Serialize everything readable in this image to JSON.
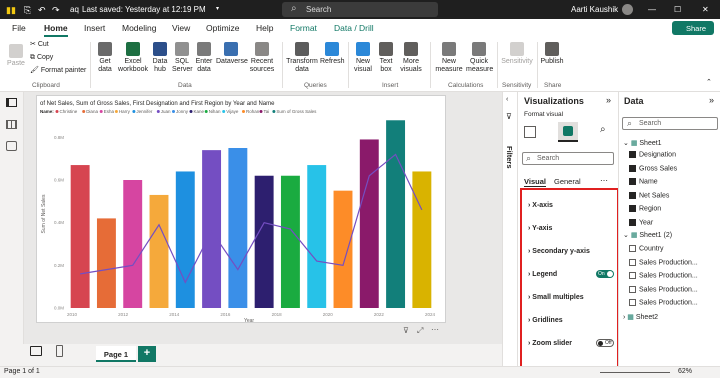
{
  "titlebar": {
    "app_name": "aq",
    "saved_status": "Last saved: Yesterday at 12:19 PM",
    "search_placeholder": "Search",
    "user_name": "Aarti Kaushik"
  },
  "menu": {
    "tabs": [
      "File",
      "Home",
      "Insert",
      "Modeling",
      "View",
      "Optimize",
      "Help",
      "Format",
      "Data / Drill"
    ],
    "active": "Home",
    "share_label": "Share"
  },
  "ribbon": {
    "paste": "Paste",
    "cut": "Cut",
    "copy": "Copy",
    "format_painter": "Format painter",
    "clipboard_group": "Clipboard",
    "get_data": "Get data",
    "excel": "Excel workbook",
    "data_hub": "Data hub",
    "sql": "SQL Server",
    "enter_data": "Enter data",
    "dataverse": "Dataverse",
    "recent": "Recent sources",
    "data_group": "Data",
    "transform": "Transform data",
    "refresh": "Refresh",
    "queries_group": "Queries",
    "new_visual": "New visual",
    "text_box": "Text box",
    "more_visuals": "More visuals",
    "insert_group": "Insert",
    "new_measure": "New measure",
    "quick_measure": "Quick measure",
    "calc_group": "Calculations",
    "sensitivity": "Sensitivity",
    "sensitivity_group": "Sensitivity",
    "publish": "Publish",
    "share_group": "Share"
  },
  "chart_data": {
    "type": "bar",
    "title": "of Net Sales, Sum of Gross Sales, First Designation and First Region by Year and Name",
    "legend_title": "Name",
    "legend": [
      "Christine",
      "Diana",
      "Esha",
      "Harry",
      "Jennifer",
      "Juan",
      "Jonny",
      "Kane",
      "Nihan",
      "Vijaye",
      "Rohan",
      "Tai",
      "Sum of Gross Sales"
    ],
    "x_ticks": [
      "2010",
      "2012",
      "2014",
      "2016",
      "2018",
      "2020",
      "2022",
      "2024"
    ],
    "y_ticks": [
      "0.0M",
      "0.2M",
      "0.4M",
      "0.6M",
      "0.8M"
    ],
    "xlabel": "Year",
    "ylabel": "Sum of Net Sales",
    "ylim": [
      0,
      0.9
    ],
    "bar_values": [
      0.67,
      0.42,
      0.6,
      0.53,
      0.64,
      0.74,
      0.75,
      0.62,
      0.62,
      0.67,
      0.55,
      0.79,
      0.88,
      0.64
    ],
    "bar_colors": [
      "#d64550",
      "#e66c37",
      "#d645a1",
      "#f5a93b",
      "#1e90e0",
      "#744ec2",
      "#3a8fe8",
      "#2d1f6f",
      "#1aab40",
      "#27c2e8",
      "#fd8c28",
      "#8a1a6a",
      "#127f7a",
      "#d9b300"
    ],
    "line_values": [
      0.16,
      0.18,
      0.2,
      0.39,
      0.12,
      0.36,
      0.18,
      0.4,
      0.37,
      0.22,
      0.2,
      0.62,
      0.72,
      0.46
    ],
    "line_color": "#744ec2"
  },
  "canvas": {
    "page_tab": "Page 1",
    "add_page": "+"
  },
  "filters": {
    "label": "Filters"
  },
  "viz_pane": {
    "title": "Visualizations",
    "subtitle": "Format visual",
    "search_placeholder": "Search",
    "tab_visual": "Visual",
    "tab_general": "General",
    "sections": [
      "X-axis",
      "Y-axis",
      "Secondary y-axis",
      "Legend",
      "Small multiples",
      "Gridlines",
      "Zoom slider"
    ],
    "legend_toggle": "On",
    "zoom_toggle": "Off"
  },
  "data_pane": {
    "title": "Data",
    "search_placeholder": "Search",
    "sheet1": "Sheet1",
    "sheet1_fields": [
      "Designation",
      "Gross Sales",
      "Name",
      "Net Sales",
      "Region",
      "Year"
    ],
    "sheet1_2": "Sheet1 (2)",
    "sheet1_2_fields": [
      "Country",
      "Sales Production...",
      "Sales Production...",
      "Sales Production...",
      "Sales Production..."
    ],
    "sheet2": "Sheet2"
  },
  "status": {
    "page": "Page 1 of 1",
    "zoom": "62%"
  }
}
